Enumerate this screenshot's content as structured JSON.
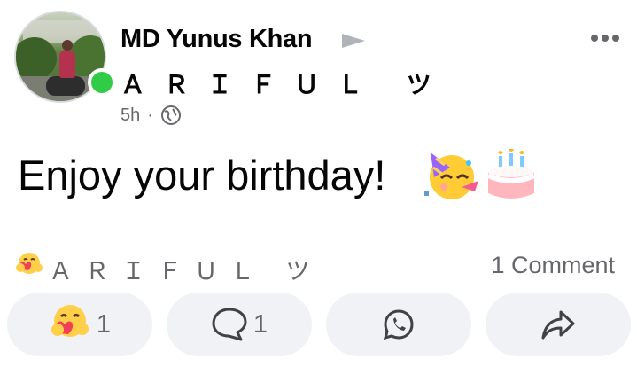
{
  "post": {
    "author": "MD Yunus Khan",
    "target": "ＡＲＩＦＵＬ ツ",
    "time": "5h",
    "separator": "·",
    "privacy_icon": "globe-icon",
    "text": "Enjoy your birthday!",
    "emojis": [
      "partying-face-icon",
      "birthday-cake-icon"
    ]
  },
  "reactions": {
    "icon": "care-heart-face-icon",
    "top_name": "ＡＲＩＦＵＬ ツ",
    "comments": "1 Comment"
  },
  "actions": {
    "reaction_count": "1",
    "comment_count": "1",
    "whatsapp_icon": "whatsapp-icon",
    "share_icon": "share-arrow-icon"
  },
  "colors": {
    "online": "#31cc46",
    "meta_text": "#65676b",
    "button_bg": "#f0f2f5"
  }
}
